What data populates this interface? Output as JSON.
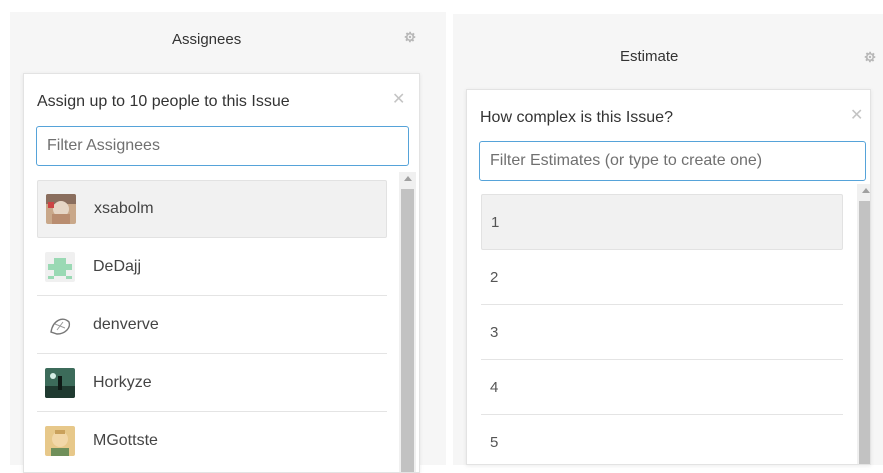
{
  "assignees": {
    "panel_title": "Assignees",
    "popover_title": "Assign up to 10 people to this Issue",
    "filter_placeholder": "Filter Assignees",
    "users": [
      {
        "name": "xsabolm",
        "avatar": "photo-avatar"
      },
      {
        "name": "DeDajj",
        "avatar": "identicon-avatar"
      },
      {
        "name": "denverve",
        "avatar": "sketch-avatar"
      },
      {
        "name": "Horkyze",
        "avatar": "photo-avatar"
      },
      {
        "name": "MGottste",
        "avatar": "photo-avatar"
      }
    ]
  },
  "estimate": {
    "panel_title": "Estimate",
    "popover_title": "How complex is this Issue?",
    "filter_placeholder": "Filter Estimates (or type to create one)",
    "options": [
      "1",
      "2",
      "3",
      "4",
      "5"
    ]
  },
  "colors": {
    "focus_border": "#56a3d9",
    "panel_bg": "#f6f6f6",
    "selected_row_bg": "#f1f1f1"
  }
}
